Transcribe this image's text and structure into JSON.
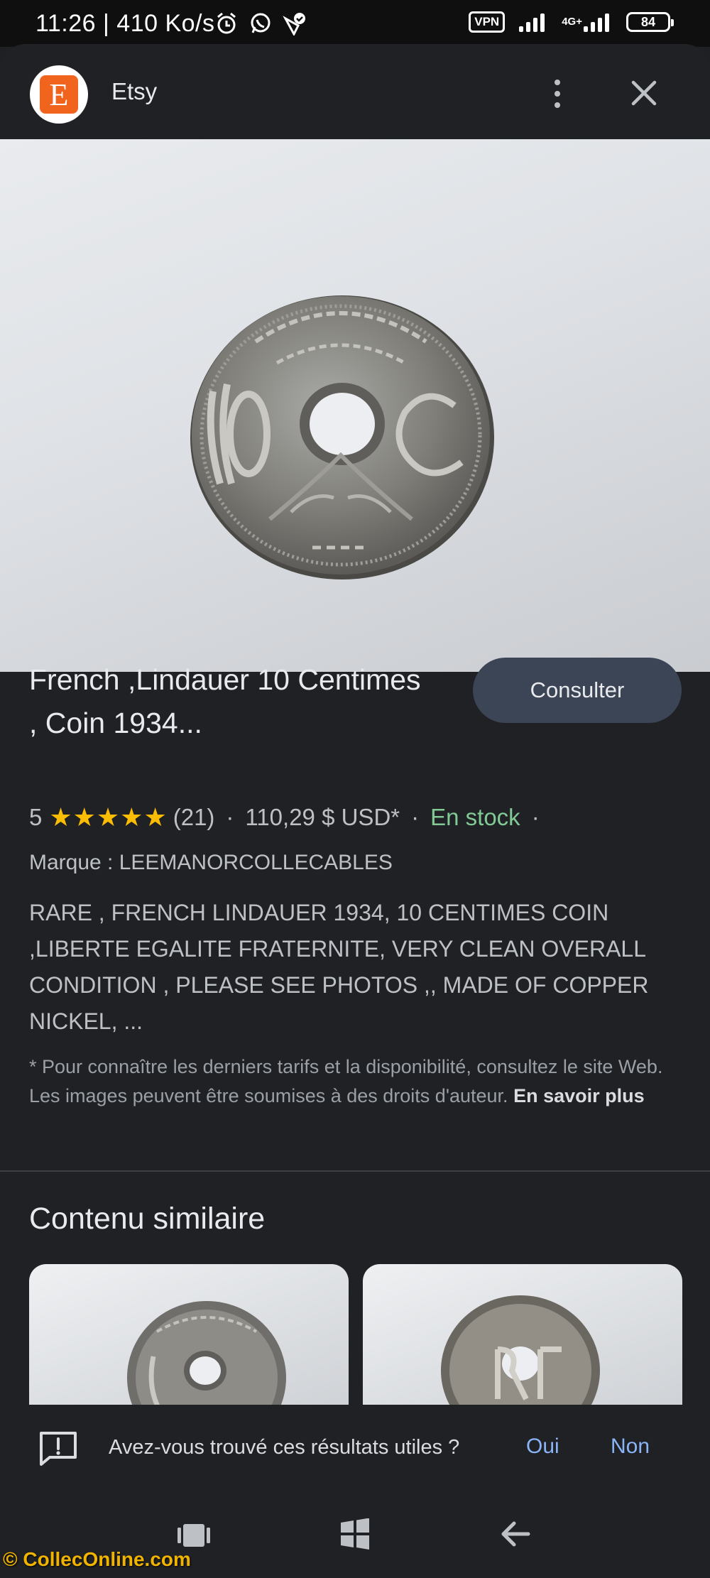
{
  "status_bar": {
    "time": "11:26 | 410 Ko/s",
    "vpn": "VPN",
    "network": "4G+",
    "battery": "84"
  },
  "header": {
    "site_logo_letter": "E",
    "site_name": "Etsy",
    "brand_color": "#f1641e"
  },
  "product": {
    "title": "French ,Lindauer 10 Centimes , Coin 1934...",
    "visit_label": "Consulter",
    "rating": "5",
    "stars": "★★★★★",
    "review_count": "(21)",
    "price": "110,29 $ USD*",
    "availability": "En stock",
    "brand": "Marque : LEEMANORCOLLECABLES",
    "description": "RARE , FRENCH LINDAUER 1934, 10 CENTIMES COIN ,LIBERTE EGALITE FRATERNITE, VERY CLEAN OVERALL CONDITION , PLEASE SEE PHOTOS ,, MADE OF COPPER NICKEL, ...",
    "disclaimer": "* Pour connaître les derniers tarifs et la disponibilité, consultez le site Web. Les images peuvent être soumises à des droits d'auteur.",
    "disclaimer_link": "En savoir plus"
  },
  "similar": {
    "title": "Contenu similaire"
  },
  "feedback": {
    "question": "Avez-vous trouvé ces résultats utiles ?",
    "yes": "Oui",
    "no": "Non"
  },
  "watermark": "© CollecOnline.com"
}
